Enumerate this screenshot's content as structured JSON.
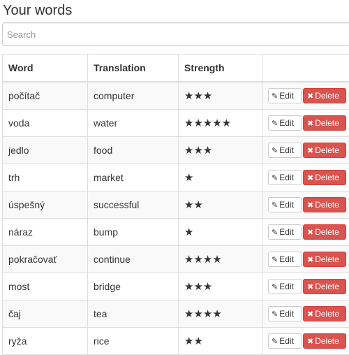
{
  "page": {
    "title": "Your words"
  },
  "search": {
    "placeholder": "Search",
    "value": ""
  },
  "table": {
    "headers": {
      "word": "Word",
      "translation": "Translation",
      "strength": "Strength",
      "actions": ""
    },
    "edit_label": "Edit",
    "delete_label": "Delete",
    "edit_icon": "pencil-icon",
    "delete_icon": "times-icon",
    "delete_color": "#d9534f",
    "rows": [
      {
        "word": "počítač",
        "translation": "computer",
        "strength": 3,
        "stars": "★★★"
      },
      {
        "word": "voda",
        "translation": "water",
        "strength": 5,
        "stars": "★★★★★"
      },
      {
        "word": "jedlo",
        "translation": "food",
        "strength": 3,
        "stars": "★★★"
      },
      {
        "word": "trh",
        "translation": "market",
        "strength": 1,
        "stars": "★"
      },
      {
        "word": "úspešný",
        "translation": "successful",
        "strength": 2,
        "stars": "★★"
      },
      {
        "word": "náraz",
        "translation": "bump",
        "strength": 1,
        "stars": "★"
      },
      {
        "word": "pokračovať",
        "translation": "continue",
        "strength": 4,
        "stars": "★★★★"
      },
      {
        "word": "most",
        "translation": "bridge",
        "strength": 3,
        "stars": "★★★"
      },
      {
        "word": "čaj",
        "translation": "tea",
        "strength": 4,
        "stars": "★★★★"
      },
      {
        "word": "ryža",
        "translation": "rice",
        "strength": 2,
        "stars": "★★"
      }
    ]
  }
}
